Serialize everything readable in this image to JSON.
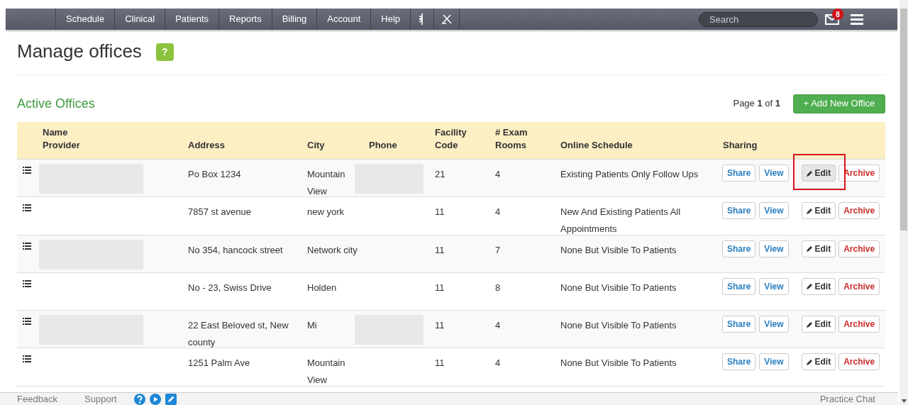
{
  "nav": {
    "items": [
      {
        "kind": "text",
        "label": "Schedule"
      },
      {
        "kind": "text",
        "label": "Clinical"
      },
      {
        "kind": "text",
        "label": "Patients"
      },
      {
        "kind": "text",
        "label": "Reports"
      },
      {
        "kind": "text",
        "label": "Billing"
      },
      {
        "kind": "text",
        "label": "Account"
      },
      {
        "kind": "text",
        "label": "Help"
      },
      {
        "kind": "staff"
      },
      {
        "kind": "tools"
      }
    ],
    "search": {
      "placeholder": "Search"
    },
    "mail_badge": "8"
  },
  "page": {
    "title": "Manage offices",
    "help": "?"
  },
  "section": {
    "title": "Active Offices",
    "pager": "Page **1** of **1**",
    "add_button": "+ Add New Office"
  },
  "table": {
    "columns": [
      {
        "label": "Name\nProvider"
      },
      {
        "label": "Address"
      },
      {
        "label": "City"
      },
      {
        "label": "Phone"
      },
      {
        "label": "Facility\nCode"
      },
      {
        "label": "# Exam\nRooms"
      },
      {
        "label": "Online Schedule"
      },
      {
        "label": "Sharing"
      }
    ],
    "rows": [
      {
        "name_redacted": true,
        "address": "Po Box 1234",
        "city": "Mountain View",
        "phone_redacted": true,
        "facility_code": "21",
        "exam_rooms": "4",
        "online_schedule": "Existing Patients Only Follow Ups",
        "highlighted": true,
        "buttons": [
          {
            "kind": "share",
            "label": "Share"
          },
          {
            "kind": "view",
            "label": "View"
          },
          {
            "kind": "edit",
            "label": "Edit"
          },
          {
            "kind": "archive",
            "label": "Archive"
          }
        ]
      },
      {
        "name_redacted": false,
        "address": "7857 st avenue",
        "city": "new york",
        "phone_redacted": false,
        "facility_code": "11",
        "exam_rooms": "4",
        "online_schedule": "New And Existing Patients All Appointments",
        "highlighted": false,
        "buttons": [
          {
            "kind": "share",
            "label": "Share"
          },
          {
            "kind": "view",
            "label": "View"
          },
          {
            "kind": "edit",
            "label": "Edit"
          },
          {
            "kind": "archive",
            "label": "Archive"
          }
        ]
      },
      {
        "name_redacted": true,
        "address": "No 354, hancock street",
        "city": "Network city",
        "phone_redacted": false,
        "facility_code": "11",
        "exam_rooms": "7",
        "online_schedule": "None But Visible To Patients",
        "highlighted": false,
        "buttons": [
          {
            "kind": "share",
            "label": "Share"
          },
          {
            "kind": "view",
            "label": "View"
          },
          {
            "kind": "edit",
            "label": "Edit"
          },
          {
            "kind": "archive",
            "label": "Archive"
          }
        ]
      },
      {
        "name_redacted": false,
        "address": "No - 23, Swiss Drive",
        "city": "Holden",
        "phone_redacted": false,
        "facility_code": "11",
        "exam_rooms": "8",
        "online_schedule": "None But Visible To Patients",
        "highlighted": false,
        "buttons": [
          {
            "kind": "share",
            "label": "Share"
          },
          {
            "kind": "view",
            "label": "View"
          },
          {
            "kind": "edit",
            "label": "Edit"
          },
          {
            "kind": "archive",
            "label": "Archive"
          }
        ]
      },
      {
        "name_redacted": true,
        "address": "22 East Beloved st, New county",
        "city": "Mi",
        "phone_redacted": true,
        "facility_code": "11",
        "exam_rooms": "4",
        "online_schedule": "None But Visible To Patients",
        "highlighted": false,
        "buttons": [
          {
            "kind": "share",
            "label": "Share"
          },
          {
            "kind": "view",
            "label": "View"
          },
          {
            "kind": "edit",
            "label": "Edit"
          },
          {
            "kind": "archive",
            "label": "Archive"
          }
        ]
      },
      {
        "name_redacted": false,
        "address": "1251 Palm Ave",
        "city": "Mountain View",
        "phone_redacted": false,
        "facility_code": "11",
        "exam_rooms": "4",
        "online_schedule": "None But Visible To Patients",
        "highlighted": false,
        "buttons": [
          {
            "kind": "share",
            "label": "Share"
          },
          {
            "kind": "view",
            "label": "View"
          },
          {
            "kind": "edit",
            "label": "Edit"
          },
          {
            "kind": "archive",
            "label": "Archive"
          }
        ]
      }
    ]
  },
  "footer": {
    "links": [
      "Feedback",
      "Support"
    ],
    "chat": "Practice Chat"
  }
}
